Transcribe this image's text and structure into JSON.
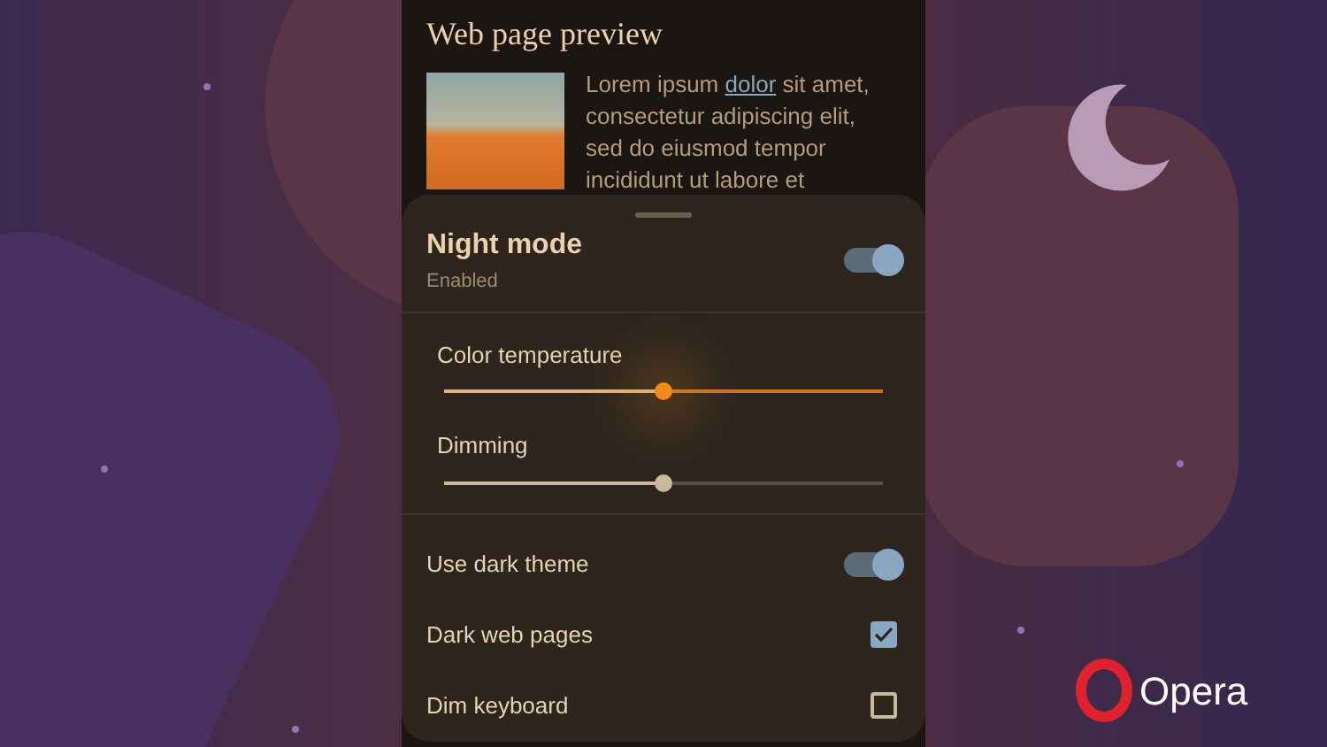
{
  "preview": {
    "title": "Web page preview",
    "text_before": "Lorem ipsum ",
    "link": "dolor",
    "text_after": " sit amet, consectetur adipiscing elit, sed do eiusmod tempor incididunt ut labore et"
  },
  "night_mode": {
    "title": "Night mode",
    "status": "Enabled",
    "on": true
  },
  "sliders": [
    {
      "kind": "warm",
      "label": "Color temperature",
      "level": 0.5
    },
    {
      "kind": "neutral",
      "label": "Dimming",
      "level": 0.5
    }
  ],
  "options": [
    {
      "kind": "switch",
      "label": "Use dark theme",
      "on": true
    },
    {
      "kind": "checkbox",
      "label": "Dark web pages",
      "checked": true
    },
    {
      "kind": "checkbox",
      "label": "Dim keyboard",
      "checked": false
    }
  ],
  "brand": {
    "name": "Opera"
  }
}
